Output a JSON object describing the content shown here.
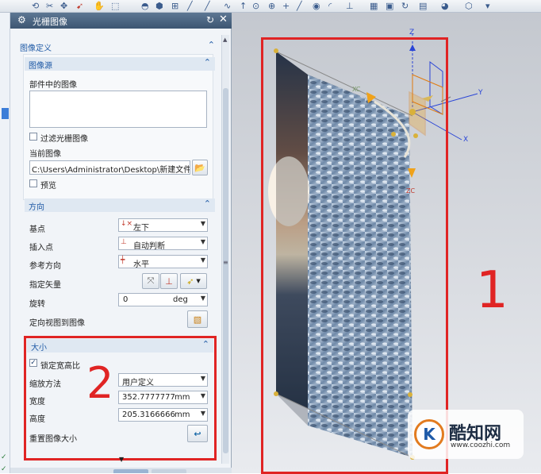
{
  "dialog": {
    "title": "光栅图像",
    "image_definition": {
      "header": "图像定义",
      "image_source": {
        "header": "图像源",
        "part_images_label": "部件中的图像",
        "filter_label": "过滤光栅图像",
        "filter_checked": false,
        "current_image_label": "当前图像",
        "current_image_path": "C:\\Users\\Administrator\\Desktop\\新建文件夹",
        "preview_label": "预览",
        "preview_checked": false
      }
    },
    "orientation": {
      "header": "方向",
      "base_point_label": "基点",
      "base_point_value": "左下",
      "insert_point_label": "插入点",
      "insert_point_value": "自动判断",
      "ref_direction_label": "参考方向",
      "ref_direction_value": "水平",
      "specify_vector_label": "指定矢量",
      "rotation_label": "旋转",
      "rotation_value": "0",
      "rotation_unit": "deg",
      "orient_view_label": "定向视图到图像"
    },
    "size": {
      "header": "大小",
      "lock_aspect_label": "锁定宽高比",
      "lock_aspect_checked": true,
      "scale_method_label": "缩放方法",
      "scale_method_value": "用户定义",
      "width_label": "宽度",
      "width_value": "352.7777777",
      "width_unit": "mm",
      "height_label": "高度",
      "height_value": "205.3166666",
      "height_unit": "mm",
      "reset_size_label": "重置图像大小"
    }
  },
  "viewport": {
    "annotation_1": "1",
    "annotation_2": "2",
    "axis_z": "Z",
    "axis_y": "Y",
    "axis_x": "X",
    "xc_label": "XC",
    "zc_label": "ZC",
    "watermark_brand": "酷知网",
    "watermark_url": "www.coozhi.com",
    "watermark_logo_letter": "K"
  },
  "colors": {
    "title_bar": "#4b6583",
    "section_header": "#1f5aa6",
    "annotation_red": "#e02424",
    "orange_handle": "#f0a21a",
    "axis_blue": "#2a45d6"
  }
}
